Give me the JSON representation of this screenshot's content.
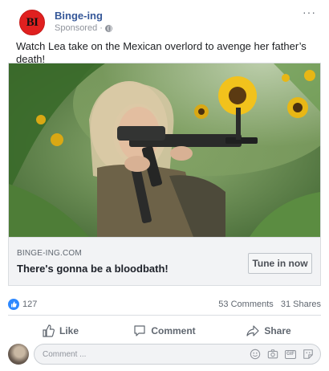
{
  "post": {
    "page_name": "Binge-ing",
    "avatar_initials": "BI",
    "sponsored_label": "Sponsored",
    "more_icon": "more-horizontal-icon",
    "text": "Watch Lea take on the Mexican overlord to avenge her father’s death!"
  },
  "card": {
    "domain": "BINGE-ING.COM",
    "title": "There's gonna be a bloodbath!",
    "cta_label": "Tune in now"
  },
  "reactions": {
    "like_count": "127",
    "comments": "53 Comments",
    "shares": "31 Shares"
  },
  "actions": {
    "like_label": "Like",
    "comment_label": "Comment",
    "share_label": "Share"
  },
  "comment_box": {
    "placeholder": "Comment ..."
  },
  "colors": {
    "brand_blue": "#365899",
    "reaction_blue": "#2d88ff",
    "avatar_red": "#e0201f"
  }
}
